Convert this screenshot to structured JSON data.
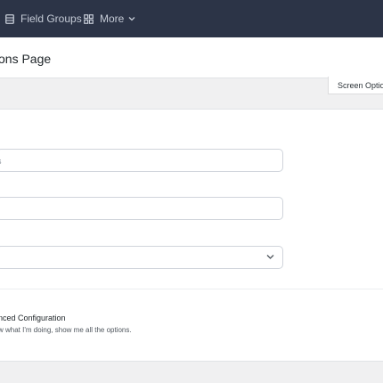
{
  "topbar": {
    "field_groups_label": "Field Groups",
    "more_label": "More"
  },
  "header": {
    "page_title": "ons Page",
    "screen_options_label": "Screen Option"
  },
  "form": {
    "field1_text": "s",
    "field2_text": "",
    "field3_text": ""
  },
  "advanced": {
    "title": "nced Configuration",
    "description": "w what I'm doing, show me all the options."
  },
  "colors": {
    "topbar": "#2c3447",
    "background": "#f0f0f1",
    "panel": "#ffffff"
  }
}
